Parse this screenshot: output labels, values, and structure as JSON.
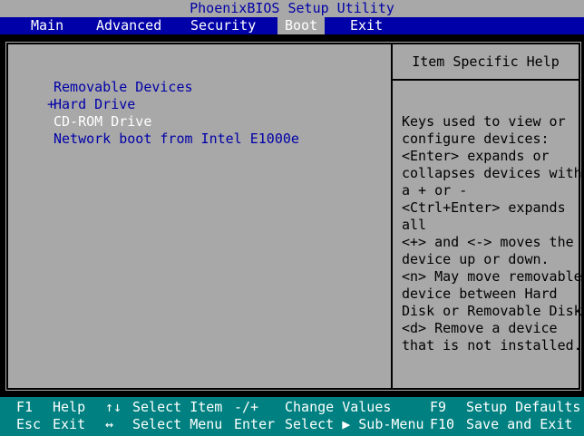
{
  "title": "PhoenixBIOS Setup Utility",
  "menu": {
    "items": [
      {
        "label": "Main",
        "active": false
      },
      {
        "label": "Advanced",
        "active": false
      },
      {
        "label": "Security",
        "active": false
      },
      {
        "label": "Boot",
        "active": true
      },
      {
        "label": "Exit",
        "active": false
      }
    ]
  },
  "boot": {
    "items": [
      {
        "prefix": "",
        "label": "Removable Devices",
        "selected": false
      },
      {
        "prefix": "+",
        "label": "Hard Drive",
        "selected": false
      },
      {
        "prefix": "",
        "label": "CD-ROM Drive",
        "selected": true
      },
      {
        "prefix": "",
        "label": "Network boot from Intel E1000e",
        "selected": false
      }
    ]
  },
  "help": {
    "title": "Item Specific Help",
    "lines": [
      "Keys used to view or",
      "configure devices:",
      "<Enter> expands or",
      "collapses devices with",
      "a + or -",
      "<Ctrl+Enter> expands",
      "all",
      "<+> and <-> moves the",
      "device up or down.",
      "<n> May move removable",
      "device between Hard",
      "Disk or Removable Disk",
      "<d> Remove a device",
      "that is not installed."
    ]
  },
  "footer": {
    "row1": {
      "k1": "F1",
      "d1": "Help",
      "k2": "↑↓",
      "d2": "Select Item",
      "k3": "-/+",
      "d3": "Change Values",
      "k4": "F9",
      "d4": "Setup Defaults"
    },
    "row2": {
      "k1": "Esc",
      "d1": "Exit",
      "k2": "↔",
      "d2": "Select Menu",
      "k3": "Enter",
      "d3": "Select ▶ Sub-Menu",
      "k4": "F10",
      "d4": "Save and Exit"
    }
  },
  "colors": {
    "background": "#000000",
    "panel": "#a8a8a8",
    "menu_bar": "#0000a8",
    "footer": "#008080",
    "item_text": "#0000a8",
    "selected_text": "#ffffff"
  }
}
